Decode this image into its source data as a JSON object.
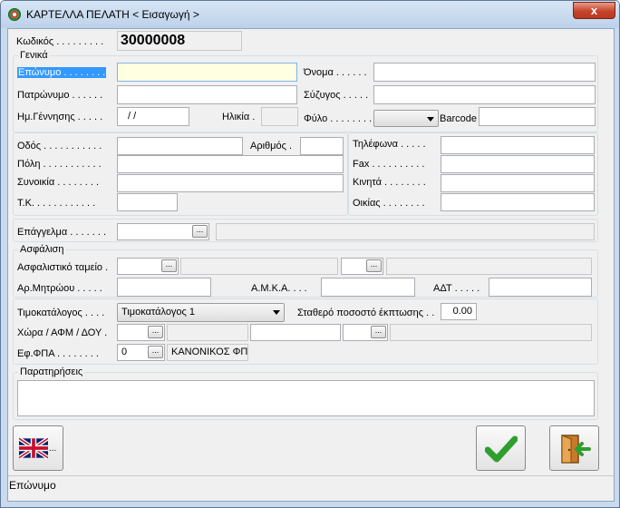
{
  "window": {
    "title": "ΚΑΡΤΕΛΛΑ ΠΕΛΑΤΗ < Εισαγωγή >",
    "close": "x"
  },
  "code": {
    "label": "Κωδικός . . . . . . . . .",
    "value": "30000008"
  },
  "general": {
    "title": "Γενικά",
    "surname_label": "Επώνυμο . . . . . . . .",
    "name_label": "Όνομα . . . . . .",
    "patronymic_label": "Πατρώνυμο . . . . . .",
    "spouse_label": "Σύζυγος . . . . .",
    "birthdate_label": "Ημ.Γέννησης . . . . .",
    "birthdate_value": "/ /",
    "age_label": "Ηλικία .",
    "gender_label": "Φύλο . . . . . . . .",
    "barcode_label": "Barcode"
  },
  "address": {
    "street_label": "Οδός . . . . . . . . . . .",
    "number_label": "Αριθμός .",
    "city_label": "Πόλη . . . . . . . . . . .",
    "district_label": "Συνοικία . . . . . . . .",
    "zip_label": "Τ.Κ. . . . . . . . . . . .",
    "phones_label": "Τηλέφωνα . . . . .",
    "fax_label": "Fax . . . . . . . . . .",
    "mobile_label": "Κινητά . . . . . . . .",
    "home_label": "Οικίας . . . . . . . ."
  },
  "profession_label": "Επάγγελμα . . . . . . .",
  "insurance": {
    "title": "Ασφάλιση",
    "fund_label": "Ασφαλιστικό ταμείο .",
    "reg_label": "Αρ.Μητρώου . . . . .",
    "amka_label": "Α.Μ.Κ.Α. . . .",
    "adt_label": "ΑΔΤ . . . . ."
  },
  "pricing": {
    "pricelist_label": "Τιμοκατάλογος . . . .",
    "pricelist_value": "Τιμοκατάλογος 1",
    "discount_label": "Σταθερό ποσοστό έκπτωσης . .",
    "discount_value": "0.00",
    "country_label": "Χώρα / ΑΦΜ / ΔΟΥ .",
    "vat_label": "Εφ.ΦΠΑ . . . . . . . .",
    "vat_code": "0",
    "vat_name": "ΚΑΝΟΝΙΚΟΣ ΦΠΑ"
  },
  "notes": {
    "title": "Παρατηρήσεις"
  },
  "buttons": {
    "lang_suffix": "...",
    "ellipsis": "..."
  },
  "status": {
    "text": "Επώνυμο"
  },
  "colors": {
    "flag_blue": "#012169",
    "flag_red": "#C8102E",
    "ok_green": "#2e9e2e",
    "exit_orange": "#d9822b"
  }
}
